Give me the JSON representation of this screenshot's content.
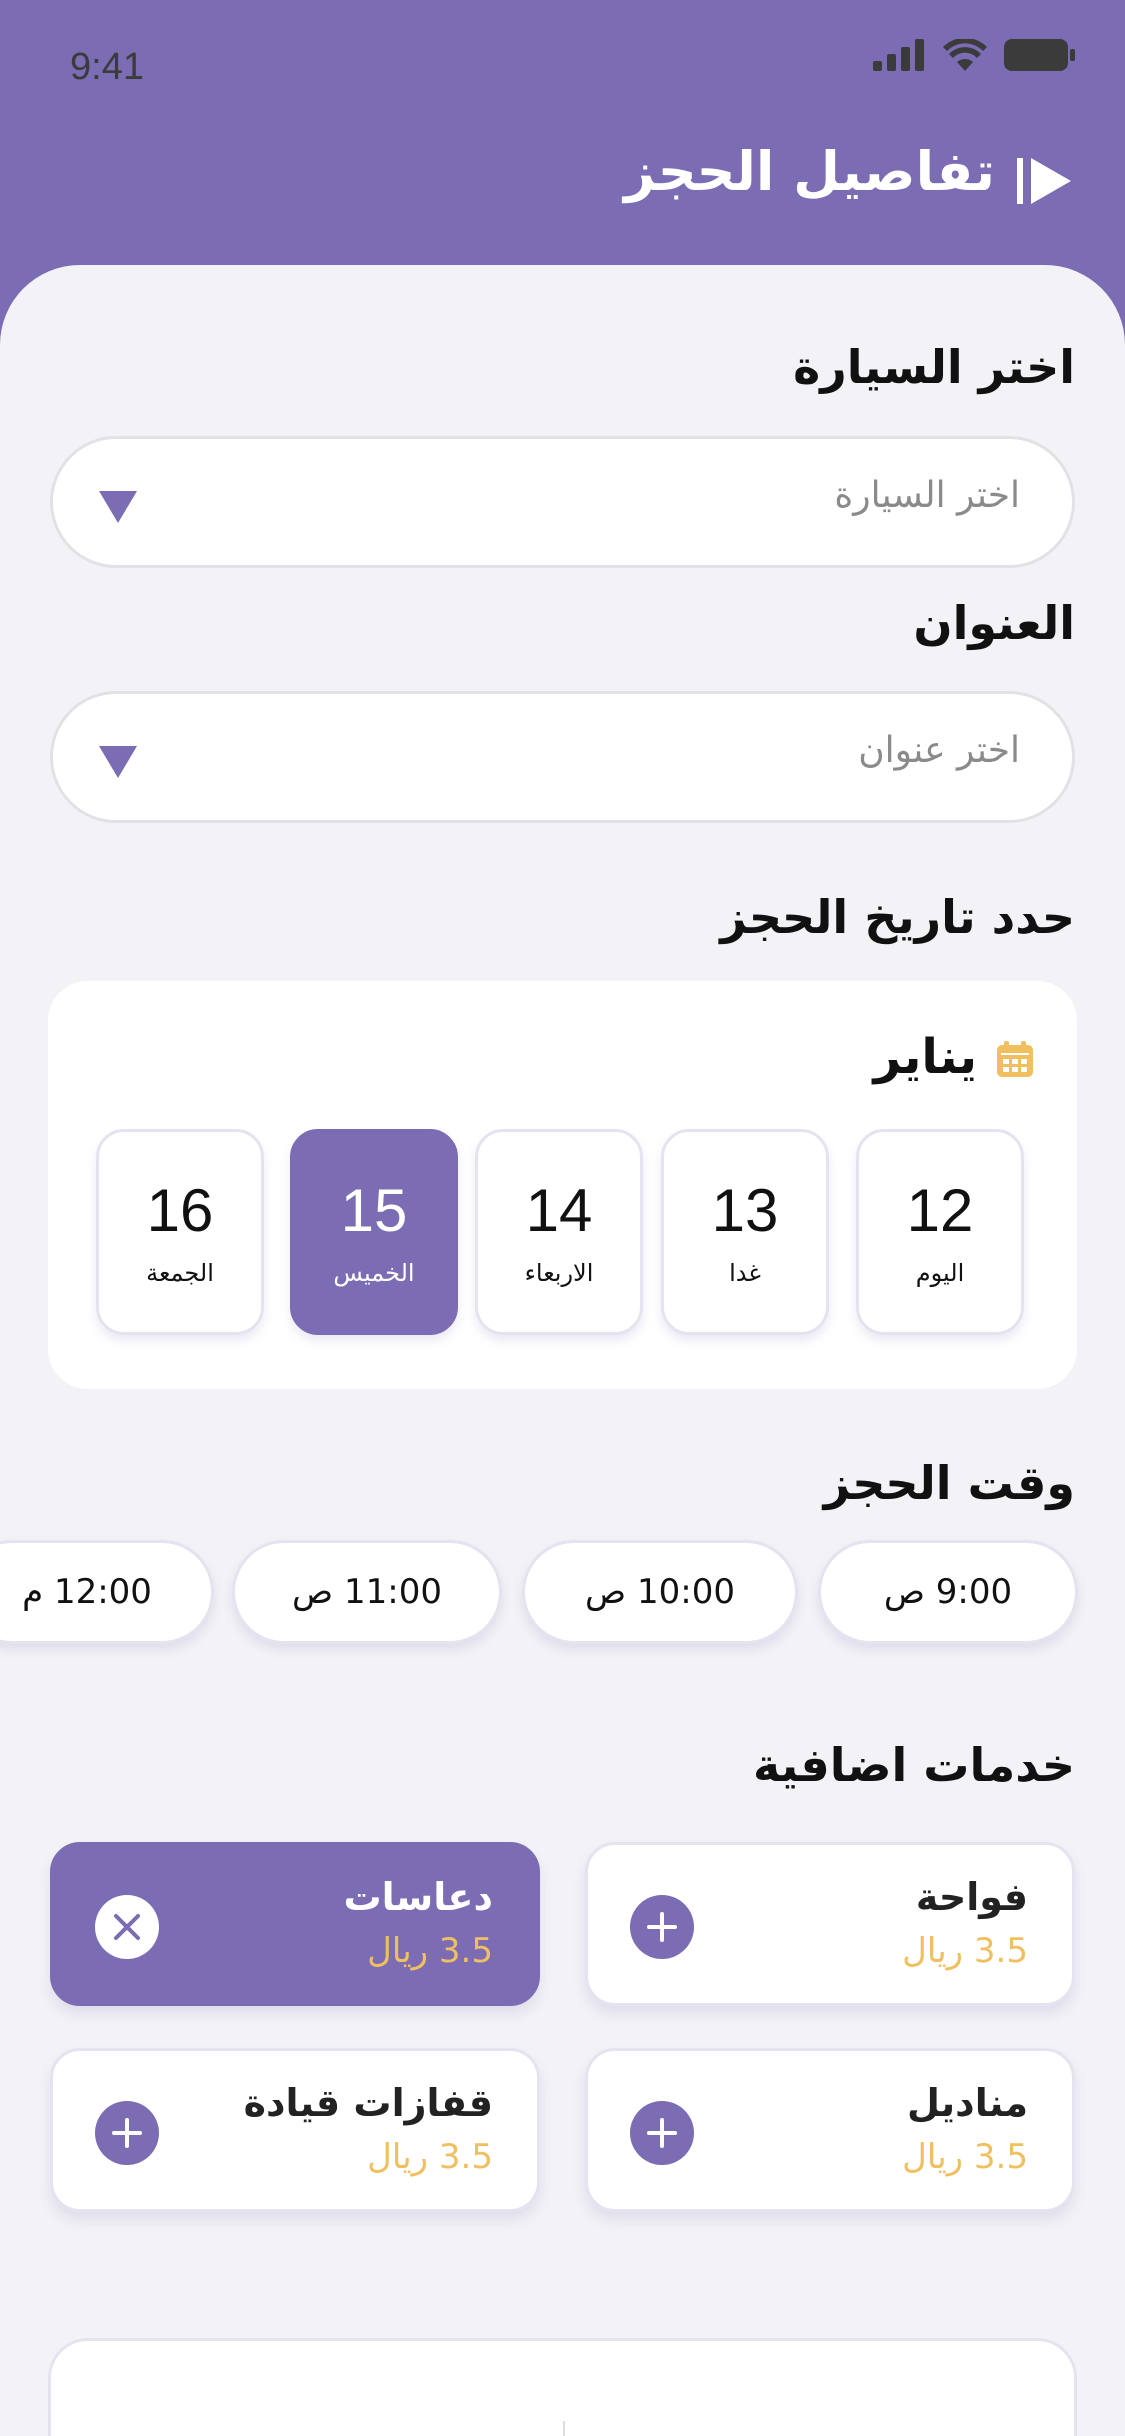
{
  "status_bar": {
    "time": "9:41"
  },
  "header": {
    "title": "تفاصيل الحجز"
  },
  "car_section": {
    "title": "اختر السيارة",
    "placeholder": "اختر السيارة"
  },
  "address_section": {
    "title": "العنوان",
    "placeholder": "اختر عنوان"
  },
  "date_section": {
    "title": "حدد تاريخ الحجز",
    "month": "يناير",
    "days": [
      {
        "num": "12",
        "label": "اليوم"
      },
      {
        "num": "13",
        "label": "غدا"
      },
      {
        "num": "14",
        "label": "الاربعاء"
      },
      {
        "num": "15",
        "label": "الخميس",
        "selected": true
      },
      {
        "num": "16",
        "label": "الجمعة"
      }
    ]
  },
  "time_section": {
    "title": "وقت الحجز",
    "slots": [
      "9:00 ص",
      "10:00 ص",
      "11:00 ص",
      "12:00 م"
    ]
  },
  "services_section": {
    "title": "خدمات اضافية",
    "items": [
      {
        "name": "فواحة",
        "price": "3.5 ريال",
        "selected": false
      },
      {
        "name": "دعاسات",
        "price": "3.5 ريال",
        "selected": true
      },
      {
        "name": "مناديل",
        "price": "3.5 ريال",
        "selected": false
      },
      {
        "name": "قفازات قيادة",
        "price": "3.5 ريال",
        "selected": false
      }
    ]
  },
  "colors": {
    "primary": "#7b6cb3",
    "accent": "#f0c060",
    "background": "#f3f2f6"
  }
}
